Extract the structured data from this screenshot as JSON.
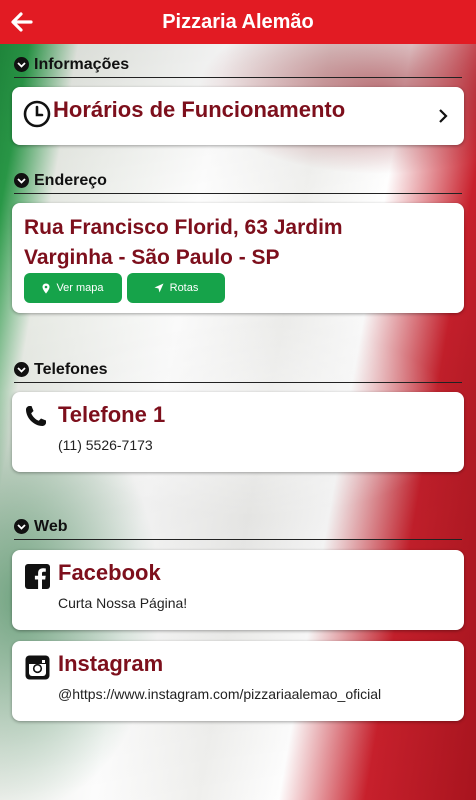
{
  "header": {
    "title": "Pizzaria Alemão",
    "back_icon": "arrow-left-icon",
    "bg_color": "#e21b23"
  },
  "sections": {
    "info": {
      "label": "Informações",
      "item": {
        "title": "Horários de Funcionamento",
        "icon": "clock-icon",
        "trailing_icon": "chevron-right-icon"
      }
    },
    "address": {
      "label": "Endereço",
      "line1": "Rua Francisco Florid, 63 Jardim",
      "line2": "Varginha - São Paulo - SP",
      "map_button": "Ver mapa",
      "route_button": "Rotas",
      "button_color": "#16a34a"
    },
    "phones": {
      "label": "Telefones",
      "item": {
        "title": "Telefone 1",
        "number": "(11) 5526-7173",
        "icon": "phone-icon"
      }
    },
    "web": {
      "label": "Web",
      "facebook": {
        "title": "Facebook",
        "subtitle": "Curta Nossa Página!",
        "icon": "facebook-icon"
      },
      "instagram": {
        "title": "Instagram",
        "subtitle": "@https://www.instagram.com/pizzariaalemao_oficial",
        "icon": "instagram-icon"
      }
    }
  },
  "accent_color": "#7d0f1c"
}
